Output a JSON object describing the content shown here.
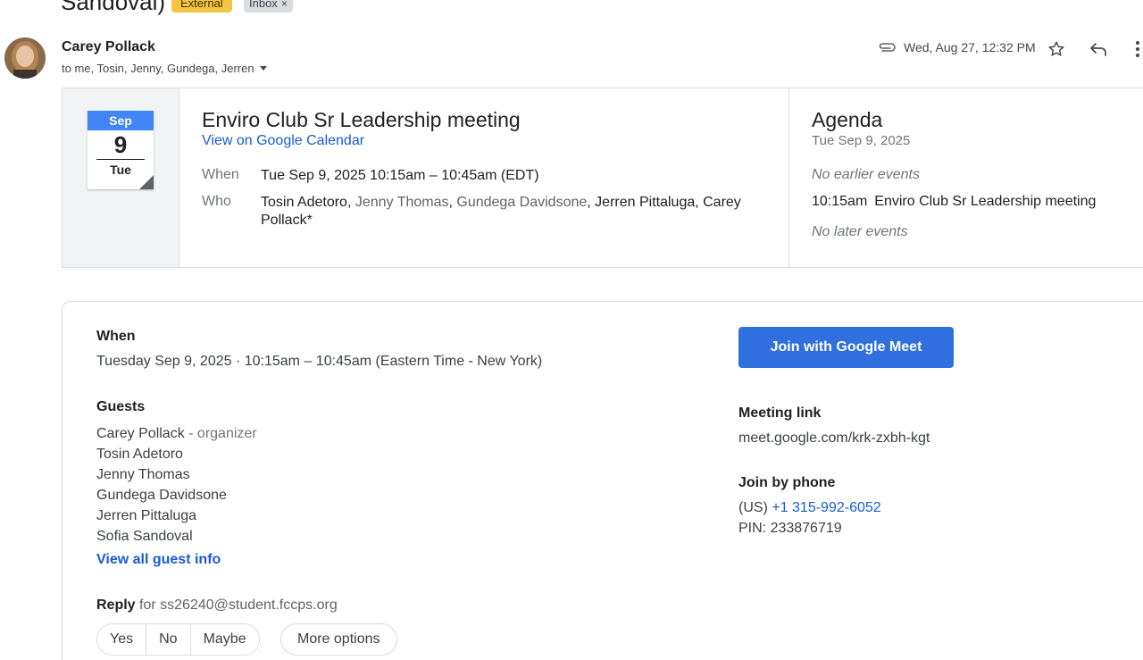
{
  "header": {
    "subject_fragment": "Sandoval)",
    "labels": {
      "external": "External",
      "inbox": "Inbox",
      "inbox_remove": "×"
    }
  },
  "message": {
    "sender_name": "Carey Pollack",
    "recipients": "to me, Tosin, Jenny, Gundega, Jerren",
    "date": "Wed, Aug 27, 12:32 PM",
    "icons": [
      "attachment-icon",
      "star-icon",
      "reply-icon",
      "more-vert-icon"
    ]
  },
  "calendar_card": {
    "tile": {
      "month": "Sep",
      "day": "9",
      "weekday": "Tue"
    },
    "event_title": "Enviro Club Sr Leadership meeting",
    "view_link": "View on Google Calendar",
    "when_label": "When",
    "when_value": "Tue Sep 9, 2025 10:15am – 10:45am (EDT)",
    "who_label": "Who",
    "who": [
      {
        "name": "Tosin Adetoro",
        "sep": ", "
      },
      {
        "name": "Jenny Thomas",
        "sep": ", "
      },
      {
        "name": "Gundega Davidsone",
        "sep": ", "
      },
      {
        "name": "Jerren Pittaluga",
        "sep": ", "
      },
      {
        "name": "Carey Pollack*",
        "sep": ""
      }
    ],
    "agenda": {
      "title": "Agenda",
      "date": "Tue Sep 9, 2025",
      "no_earlier": "No earlier events",
      "event_time": "10:15am",
      "event_title": "Enviro Club Sr Leadership meeting",
      "no_later": "No later events"
    }
  },
  "invite": {
    "when_label": "When",
    "when_value": "Tuesday Sep 9, 2025 · 10:15am – 10:45am (Eastern Time - New York)",
    "guests_label": "Guests",
    "organizer_name": "Carey Pollack",
    "organizer_suffix": " - organizer",
    "guests": [
      "Tosin Adetoro",
      "Jenny Thomas",
      "Gundega Davidsone",
      "Jerren Pittaluga",
      "Sofia Sandoval"
    ],
    "view_all_guests": "View all guest info",
    "reply_label": "Reply",
    "reply_for": " for ss26240@student.fccps.org",
    "rsvp": [
      "Yes",
      "No",
      "Maybe"
    ],
    "more_options": "More options",
    "join_button": "Join with Google Meet",
    "meeting_link_label": "Meeting link",
    "meeting_link": "meet.google.com/krk-zxbh-kgt",
    "phone_label": "Join by phone",
    "phone_region": "(US) ",
    "phone_number": "+1 315-992-6052",
    "pin": "PIN: 233876719"
  },
  "colors": {
    "accent_blue": "#1a5bd6",
    "meet_button": "#2f6fde",
    "external_label": "#f4c542",
    "calendar_month": "#4285f4"
  }
}
